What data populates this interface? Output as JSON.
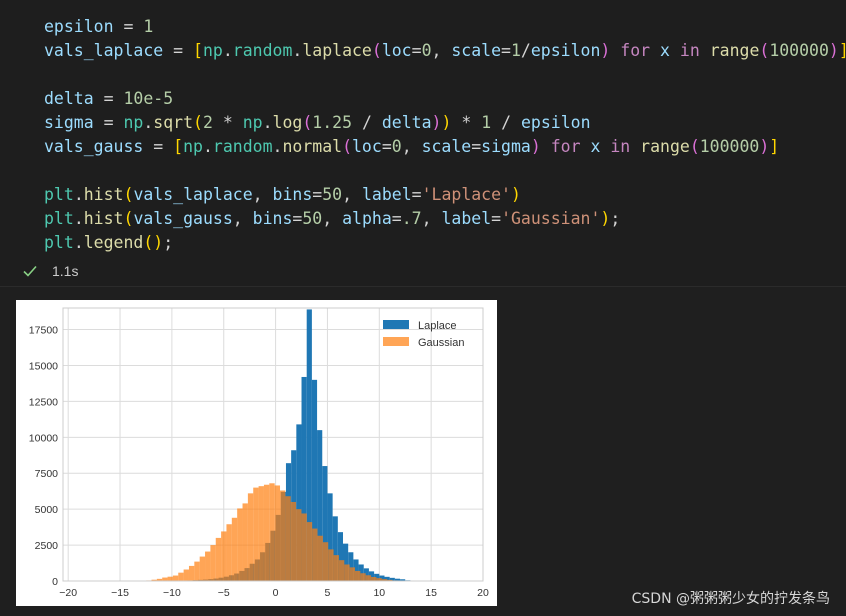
{
  "code_cell": {
    "lines": [
      [
        {
          "t": "epsilon",
          "c": "v"
        },
        {
          "t": " = ",
          "c": "op"
        },
        {
          "t": "1",
          "c": "num"
        }
      ],
      [
        {
          "t": "vals_laplace",
          "c": "v"
        },
        {
          "t": " = ",
          "c": "op"
        },
        {
          "t": "[",
          "c": "p1"
        },
        {
          "t": "np",
          "c": "mod"
        },
        {
          "t": ".",
          "c": "op"
        },
        {
          "t": "random",
          "c": "mod"
        },
        {
          "t": ".",
          "c": "op"
        },
        {
          "t": "laplace",
          "c": "fn"
        },
        {
          "t": "(",
          "c": "p2"
        },
        {
          "t": "loc",
          "c": "v"
        },
        {
          "t": "=",
          "c": "op"
        },
        {
          "t": "0",
          "c": "num"
        },
        {
          "t": ", ",
          "c": "op"
        },
        {
          "t": "scale",
          "c": "v"
        },
        {
          "t": "=",
          "c": "op"
        },
        {
          "t": "1",
          "c": "num"
        },
        {
          "t": "/",
          "c": "op"
        },
        {
          "t": "epsilon",
          "c": "v"
        },
        {
          "t": ")",
          "c": "p2"
        },
        {
          "t": " for ",
          "c": "kw"
        },
        {
          "t": "x",
          "c": "v"
        },
        {
          "t": " in ",
          "c": "kw"
        },
        {
          "t": "range",
          "c": "fn"
        },
        {
          "t": "(",
          "c": "p2"
        },
        {
          "t": "100000",
          "c": "num"
        },
        {
          "t": ")",
          "c": "p2"
        },
        {
          "t": "]",
          "c": "p1"
        }
      ],
      [],
      [
        {
          "t": "delta",
          "c": "v"
        },
        {
          "t": " = ",
          "c": "op"
        },
        {
          "t": "10e-5",
          "c": "num"
        }
      ],
      [
        {
          "t": "sigma",
          "c": "v"
        },
        {
          "t": " = ",
          "c": "op"
        },
        {
          "t": "np",
          "c": "mod"
        },
        {
          "t": ".",
          "c": "op"
        },
        {
          "t": "sqrt",
          "c": "fn"
        },
        {
          "t": "(",
          "c": "p1"
        },
        {
          "t": "2",
          "c": "num"
        },
        {
          "t": " * ",
          "c": "op"
        },
        {
          "t": "np",
          "c": "mod"
        },
        {
          "t": ".",
          "c": "op"
        },
        {
          "t": "log",
          "c": "fn"
        },
        {
          "t": "(",
          "c": "p2"
        },
        {
          "t": "1.25",
          "c": "num"
        },
        {
          "t": " / ",
          "c": "op"
        },
        {
          "t": "delta",
          "c": "v"
        },
        {
          "t": ")",
          "c": "p2"
        },
        {
          "t": ")",
          "c": "p1"
        },
        {
          "t": " * ",
          "c": "op"
        },
        {
          "t": "1",
          "c": "num"
        },
        {
          "t": " / ",
          "c": "op"
        },
        {
          "t": "epsilon",
          "c": "v"
        }
      ],
      [
        {
          "t": "vals_gauss",
          "c": "v"
        },
        {
          "t": " = ",
          "c": "op"
        },
        {
          "t": "[",
          "c": "p1"
        },
        {
          "t": "np",
          "c": "mod"
        },
        {
          "t": ".",
          "c": "op"
        },
        {
          "t": "random",
          "c": "mod"
        },
        {
          "t": ".",
          "c": "op"
        },
        {
          "t": "normal",
          "c": "fn"
        },
        {
          "t": "(",
          "c": "p2"
        },
        {
          "t": "loc",
          "c": "v"
        },
        {
          "t": "=",
          "c": "op"
        },
        {
          "t": "0",
          "c": "num"
        },
        {
          "t": ", ",
          "c": "op"
        },
        {
          "t": "scale",
          "c": "v"
        },
        {
          "t": "=",
          "c": "op"
        },
        {
          "t": "sigma",
          "c": "v"
        },
        {
          "t": ")",
          "c": "p2"
        },
        {
          "t": " for ",
          "c": "kw"
        },
        {
          "t": "x",
          "c": "v"
        },
        {
          "t": " in ",
          "c": "kw"
        },
        {
          "t": "range",
          "c": "fn"
        },
        {
          "t": "(",
          "c": "p2"
        },
        {
          "t": "100000",
          "c": "num"
        },
        {
          "t": ")",
          "c": "p2"
        },
        {
          "t": "]",
          "c": "p1"
        }
      ],
      [],
      [
        {
          "t": "plt",
          "c": "mod"
        },
        {
          "t": ".",
          "c": "op"
        },
        {
          "t": "hist",
          "c": "fn"
        },
        {
          "t": "(",
          "c": "p1"
        },
        {
          "t": "vals_laplace",
          "c": "v"
        },
        {
          "t": ", ",
          "c": "op"
        },
        {
          "t": "bins",
          "c": "v"
        },
        {
          "t": "=",
          "c": "op"
        },
        {
          "t": "50",
          "c": "num"
        },
        {
          "t": ", ",
          "c": "op"
        },
        {
          "t": "label",
          "c": "v"
        },
        {
          "t": "=",
          "c": "op"
        },
        {
          "t": "'Laplace'",
          "c": "str"
        },
        {
          "t": ")",
          "c": "p1"
        }
      ],
      [
        {
          "t": "plt",
          "c": "mod"
        },
        {
          "t": ".",
          "c": "op"
        },
        {
          "t": "hist",
          "c": "fn"
        },
        {
          "t": "(",
          "c": "p1"
        },
        {
          "t": "vals_gauss",
          "c": "v"
        },
        {
          "t": ", ",
          "c": "op"
        },
        {
          "t": "bins",
          "c": "v"
        },
        {
          "t": "=",
          "c": "op"
        },
        {
          "t": "50",
          "c": "num"
        },
        {
          "t": ", ",
          "c": "op"
        },
        {
          "t": "alpha",
          "c": "v"
        },
        {
          "t": "=",
          "c": "op"
        },
        {
          "t": ".7",
          "c": "num"
        },
        {
          "t": ", ",
          "c": "op"
        },
        {
          "t": "label",
          "c": "v"
        },
        {
          "t": "=",
          "c": "op"
        },
        {
          "t": "'Gaussian'",
          "c": "str"
        },
        {
          "t": ")",
          "c": "p1"
        },
        {
          "t": ";",
          "c": "op"
        }
      ],
      [
        {
          "t": "plt",
          "c": "mod"
        },
        {
          "t": ".",
          "c": "op"
        },
        {
          "t": "legend",
          "c": "fn"
        },
        {
          "t": "(",
          "c": "p1"
        },
        {
          "t": ")",
          "c": "p1"
        },
        {
          "t": ";",
          "c": "op"
        }
      ]
    ]
  },
  "status": {
    "icon": "checkmark-icon",
    "duration": "1.1s",
    "success_color": "#89d185"
  },
  "chart_data": {
    "type": "bar",
    "xlim": [
      -20.5,
      20
    ],
    "ylim": [
      0,
      19000
    ],
    "xticks": [
      -20,
      -15,
      -10,
      -5,
      0,
      5,
      10,
      15,
      20
    ],
    "yticks": [
      0,
      2500,
      5000,
      7500,
      10000,
      12500,
      15000,
      17500
    ],
    "grid": true,
    "legend_placement": "top-right",
    "series": [
      {
        "name": "Laplace",
        "color": "#1f77b4",
        "alpha": 1.0,
        "bin_start": -12,
        "bin_width": 0.5,
        "values": [
          10,
          10,
          10,
          15,
          20,
          25,
          30,
          40,
          60,
          80,
          100,
          130,
          170,
          230,
          300,
          400,
          520,
          700,
          900,
          1200,
          1500,
          2000,
          2650,
          3500,
          4600,
          6200,
          8200,
          9100,
          10900,
          14200,
          18900,
          14000,
          10500,
          8000,
          6100,
          4500,
          3400,
          2600,
          2000,
          1500,
          1150,
          880,
          670,
          500,
          380,
          290,
          220,
          160,
          120,
          50
        ]
      },
      {
        "name": "Gaussian",
        "color": "#ff7f0e",
        "alpha": 0.7,
        "bin_start": -13,
        "bin_width": 0.5164,
        "values": [
          15,
          40,
          90,
          150,
          240,
          300,
          380,
          580,
          800,
          1050,
          1350,
          1700,
          2050,
          2500,
          3000,
          3450,
          3950,
          4400,
          5050,
          5400,
          6100,
          6500,
          6600,
          6700,
          6800,
          6650,
          6300,
          5900,
          5500,
          5000,
          4700,
          4100,
          3650,
          3150,
          2700,
          2200,
          1800,
          1450,
          1150,
          950,
          700,
          540,
          400,
          280,
          200,
          130,
          80,
          40,
          20,
          8
        ]
      }
    ]
  },
  "watermark": {
    "text": "CSDN @粥粥粥少女的拧发条鸟"
  }
}
